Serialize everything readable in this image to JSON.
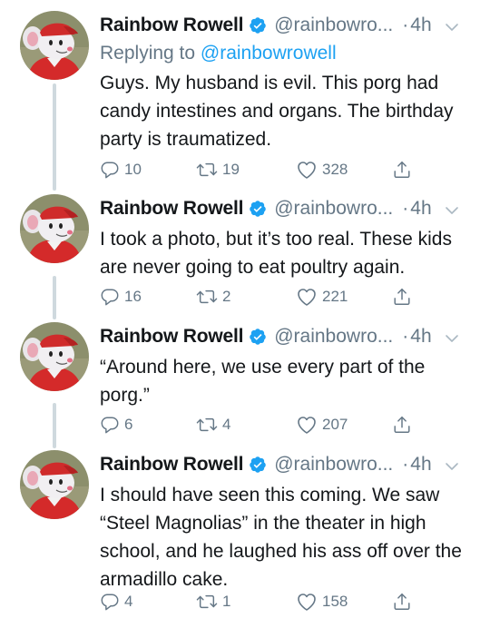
{
  "tweets": [
    {
      "author": "Rainbow Rowell",
      "handle": "@rainbowro...",
      "time": "4h",
      "reply_prefix": "Replying to ",
      "reply_to": "@rainbowrowell",
      "text": "Guys. My husband is evil. This porg had candy intestines and organs. The birthday party is traumatized.",
      "replies": "10",
      "retweets": "19",
      "likes": "328"
    },
    {
      "author": "Rainbow Rowell",
      "handle": "@rainbowro...",
      "time": "4h",
      "text": "I took a photo, but it’s too real. These kids are never going to eat poultry again.",
      "replies": "16",
      "retweets": "2",
      "likes": "221"
    },
    {
      "author": "Rainbow Rowell",
      "handle": "@rainbowro...",
      "time": "4h",
      "text": "“Around here, we use every part of the porg.”",
      "replies": "6",
      "retweets": "4",
      "likes": "207"
    },
    {
      "author": "Rainbow Rowell",
      "handle": "@rainbowro...",
      "time": "4h",
      "text": "I should have seen this coming. We saw “Steel Magnolias” in the theater in high school, and he laughed his ass off over the armadillo cake.",
      "replies": "4",
      "retweets": "1",
      "likes": "158"
    }
  ],
  "icons": {
    "verified": "verified-badge-icon",
    "more": "chevron-down-icon",
    "reply": "reply-icon",
    "retweet": "retweet-icon",
    "like": "heart-icon",
    "share": "share-icon"
  },
  "colors": {
    "accent": "#1da1f2",
    "secondary_text": "#657786",
    "thread_line": "#cfd9de"
  }
}
